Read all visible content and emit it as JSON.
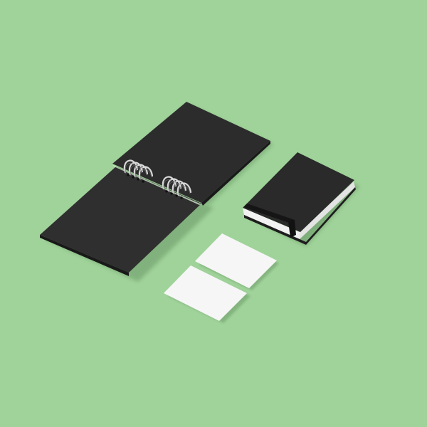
{
  "scene": {
    "background_color": "#a0d39a",
    "objects": [
      {
        "name": "spiral-notebook",
        "cover_color": "#2c2c2c",
        "binding_color": "#d9d9d9",
        "binding_rings": 2,
        "coils_per_ring": 4
      },
      {
        "name": "hardcover-notebook",
        "cover_color": "#2a2a2a",
        "page_edge_color": "#f2f2f2",
        "elastic_band_color": "#151515"
      },
      {
        "name": "business-card",
        "count": 2,
        "color": "#f6f6f6"
      }
    ]
  }
}
